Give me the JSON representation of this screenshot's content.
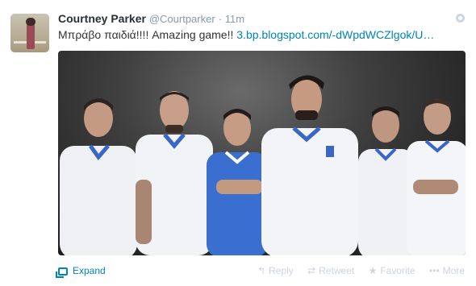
{
  "tweet": {
    "name": "Courtney Parker",
    "handle": "@Courtparker",
    "separator": "·",
    "time": "11m",
    "text_prefix": "Μπράβο παιδιά!!!! Amazing game!! ",
    "link_text": "3.bp.blogspot.com/-dWpdWCZlgok/U…"
  },
  "footer": {
    "expand_label": "Expand",
    "actions": {
      "reply": "Reply",
      "retweet": "Retweet",
      "favorite": "Favorite",
      "more": "More"
    }
  },
  "icons": {
    "options": "gear-icon",
    "expand": "expand-icon",
    "reply": "reply-icon",
    "retweet": "retweet-icon",
    "favorite": "star-icon",
    "more": "ellipsis-icon"
  },
  "colors": {
    "link": "#0084b4",
    "name": "#292f33",
    "muted": "#8899a6",
    "action_faded": "#ccd6dd"
  }
}
